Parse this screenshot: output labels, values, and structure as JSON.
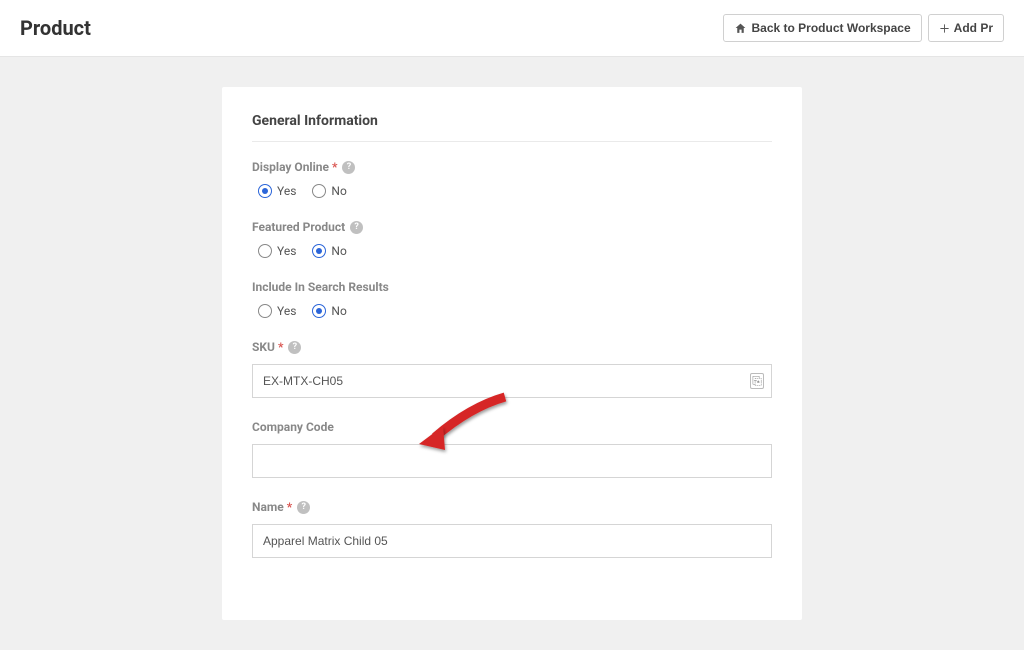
{
  "header": {
    "title": "Product",
    "back_label": "Back to Product Workspace",
    "add_label": "Add Pr"
  },
  "form": {
    "section_title": "General Information",
    "display_online": {
      "label": "Display Online",
      "required": true,
      "yes": "Yes",
      "no": "No",
      "selected": "yes"
    },
    "featured_product": {
      "label": "Featured Product",
      "yes": "Yes",
      "no": "No",
      "selected": "no"
    },
    "include_search": {
      "label": "Include In Search Results",
      "yes": "Yes",
      "no": "No",
      "selected": "no"
    },
    "sku": {
      "label": "SKU",
      "required": true,
      "value": "EX-MTX-CH05"
    },
    "company_code": {
      "label": "Company Code",
      "value": ""
    },
    "name": {
      "label": "Name",
      "required": true,
      "value": "Apparel Matrix Child 05"
    }
  }
}
